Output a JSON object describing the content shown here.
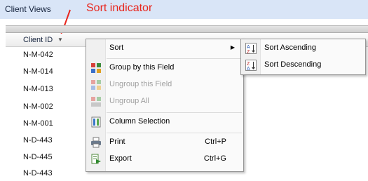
{
  "window": {
    "title": "Client Views"
  },
  "annotation": {
    "label": "Sort indicator"
  },
  "grid": {
    "column_header": "Client ID",
    "rows": [
      "N-M-042",
      "N-M-014",
      "N-M-013",
      "N-M-002",
      "N-M-001",
      "N-D-443",
      "N-D-445",
      "N-D-443"
    ]
  },
  "context_menu": {
    "sort": "Sort",
    "group_by_field": "Group by this Field",
    "ungroup_field": "Ungroup this Field",
    "ungroup_all": "Ungroup All",
    "column_selection": "Column Selection",
    "print": "Print",
    "print_shortcut": "Ctrl+P",
    "export": "Export",
    "export_shortcut": "Ctrl+G"
  },
  "sort_submenu": {
    "ascending": "Sort Ascending",
    "descending": "Sort Descending"
  },
  "colors": {
    "annotation": "#e8261d",
    "titlebar": "#d9e5f7"
  },
  "icons": {
    "sort_ascending": "az-sort-ascending-icon",
    "sort_descending": "za-sort-descending-icon",
    "group_by": "group-by-icon",
    "ungroup": "ungroup-icon",
    "ungroup_all": "ungroup-all-icon",
    "column_selection": "column-selection-icon",
    "print": "printer-icon",
    "export": "export-icon"
  }
}
